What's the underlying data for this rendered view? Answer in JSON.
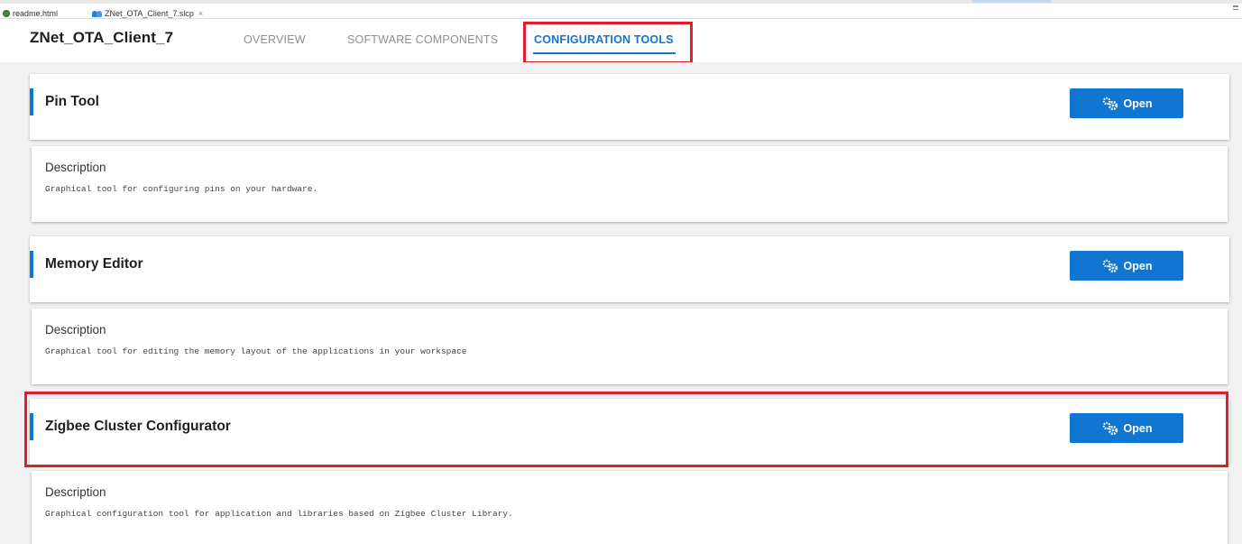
{
  "tabs": [
    {
      "label": "readme.html",
      "icon": "globe-icon"
    },
    {
      "label": "ZNet_OTA_Client_7.slcp",
      "icon": "project-icon",
      "close": "×"
    }
  ],
  "header": {
    "project_title": "ZNet_OTA_Client_7",
    "nav": {
      "overview": "OVERVIEW",
      "software_components": "SOFTWARE COMPONENTS",
      "configuration_tools": "CONFIGURATION TOOLS"
    },
    "active_tab": "CONFIGURATION TOOLS"
  },
  "tools": [
    {
      "title": "Pin Tool",
      "open_label": "Open",
      "description_label": "Description",
      "description": "Graphical tool for configuring pins on your hardware."
    },
    {
      "title": "Memory Editor",
      "open_label": "Open",
      "description_label": "Description",
      "description": "Graphical tool for editing the memory layout of the applications in your workspace"
    },
    {
      "title": "Zigbee Cluster Configurator",
      "open_label": "Open",
      "description_label": "Description",
      "description": "Graphical configuration tool for application and libraries based on Zigbee Cluster Library."
    }
  ],
  "colors": {
    "accent": "#1076d1",
    "highlight": "#e01e2e",
    "background": "#f1f1f1"
  }
}
